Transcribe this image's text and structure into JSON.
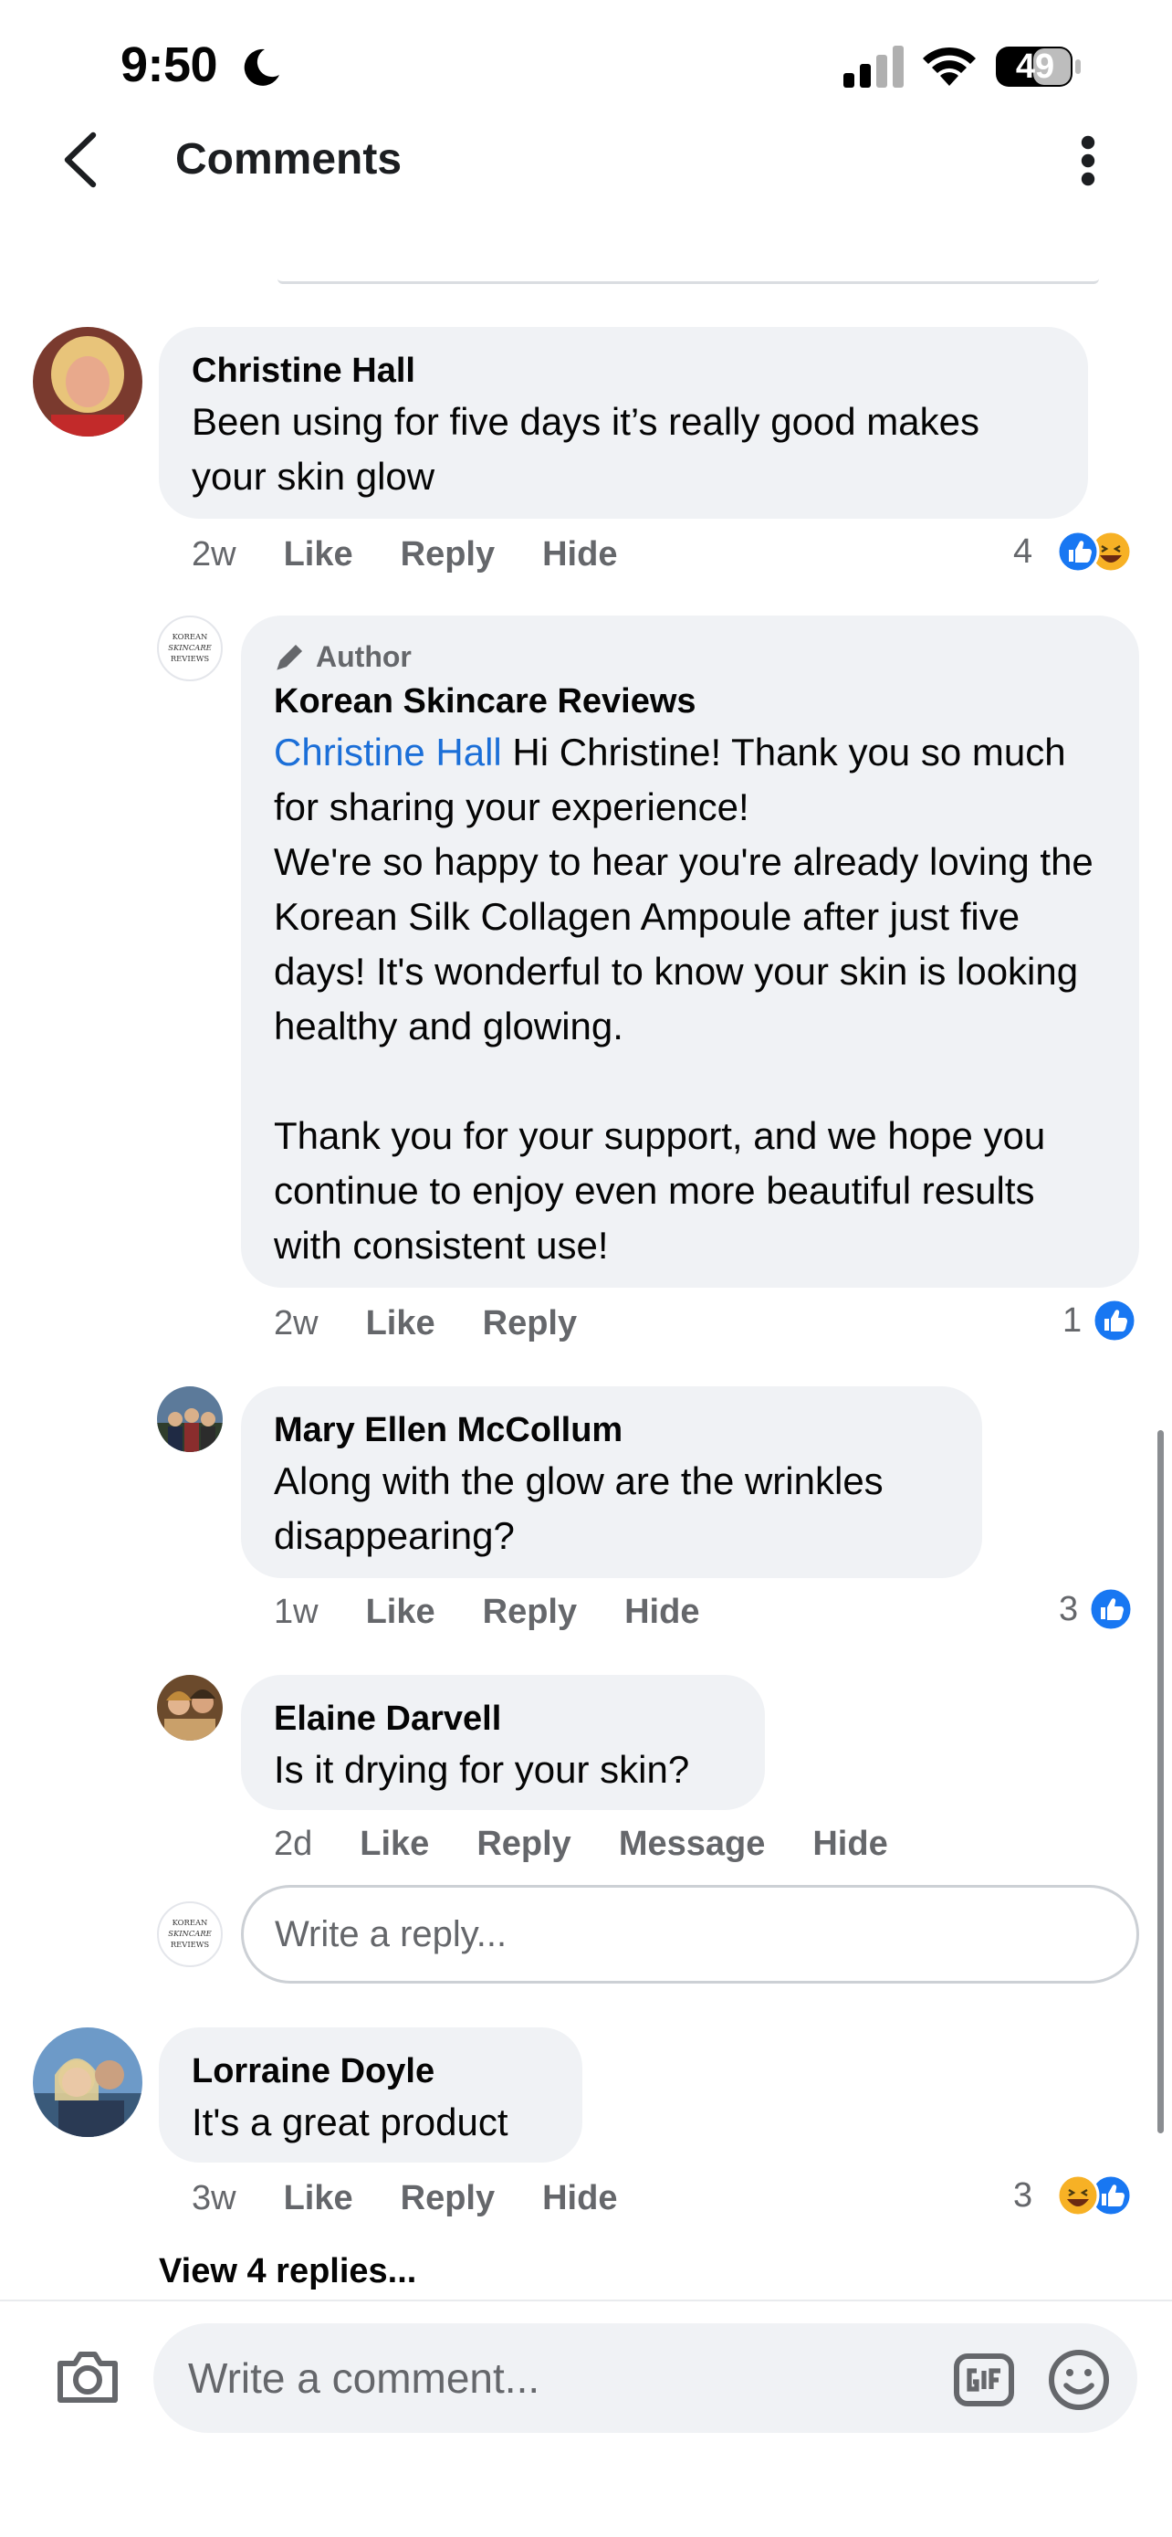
{
  "status_bar": {
    "time": "9:50",
    "battery": "49"
  },
  "header": {
    "title": "Comments"
  },
  "comments": [
    {
      "name": "Christine Hall",
      "text": "Been using for five days it’s really good makes\nyour skin glow",
      "time": "2w",
      "like": "Like",
      "reply": "Reply",
      "hide": "Hide",
      "reaction_count": "4"
    },
    {
      "author_tag": "Author",
      "name": "Korean Skincare Reviews",
      "mention": "Christine Hall",
      "text": " Hi Christine! Thank you so much for sharing your experience!\nWe're so happy to hear you're already loving the Korean Silk Collagen Ampoule after just five days! It's wonderful to know your skin is looking healthy and glowing.\n\nThank you for your support, and we hope you continue to enjoy even more beautiful results with consistent use!",
      "time": "2w",
      "like": "Like",
      "reply": "Reply",
      "reaction_count": "1"
    },
    {
      "name": "Mary Ellen McCollum",
      "text": "Along with the glow are the wrinkles\ndisappearing?",
      "time": "1w",
      "like": "Like",
      "reply": "Reply",
      "hide": "Hide",
      "reaction_count": "3"
    },
    {
      "name": "Elaine Darvell",
      "text": "Is it drying for your skin?",
      "time": "2d",
      "like": "Like",
      "reply": "Reply",
      "message": "Message",
      "hide": "Hide"
    },
    {
      "name": "Lorraine Doyle",
      "text": "It's a great product",
      "time": "3w",
      "like": "Like",
      "reply": "Reply",
      "hide": "Hide",
      "reaction_count": "3"
    }
  ],
  "reply_input": {
    "placeholder": "Write a reply..."
  },
  "view_replies": "View 4 replies...",
  "composer": {
    "placeholder": "Write a comment..."
  },
  "logo_text": "KOREAN SKINCARE REVIEWS",
  "colors": {
    "like_blue": "#1877f2",
    "mention_blue": "#1b6fd8",
    "bubble": "#f0f2f5",
    "haha_yellow": "#f7b125"
  }
}
